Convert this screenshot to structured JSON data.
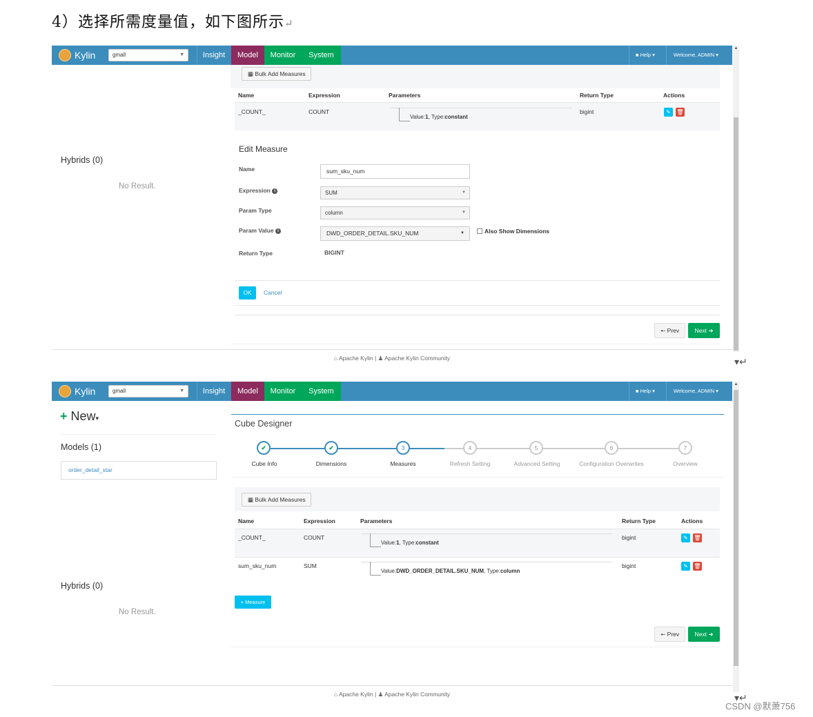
{
  "doc": {
    "heading": "4）选择所需度量值，如下图所示",
    "return_mark": "↵",
    "watermark": "CSDN @默萧756"
  },
  "nav": {
    "brand": "Kylin",
    "project": "gmall",
    "items": [
      "Insight",
      "Model",
      "Monitor",
      "System"
    ],
    "help": "Help ▾",
    "welcome": "Welcome, ADMIN ▾"
  },
  "sidebar": {
    "new_label": "New",
    "models_title": "Models (1)",
    "model_item": "order_detail_star",
    "hybrids_title": "Hybrids (0)",
    "no_result": "No Result."
  },
  "designer": {
    "title": "Cube Designer",
    "steps": [
      {
        "num": "✔",
        "label": "Cube Info"
      },
      {
        "num": "✔",
        "label": "Dimensions"
      },
      {
        "num": "3",
        "label": "Measures"
      },
      {
        "num": "4",
        "label": "Refresh Setting"
      },
      {
        "num": "5",
        "label": "Advanced Setting"
      },
      {
        "num": "6",
        "label": "Configuration Overwrites"
      },
      {
        "num": "7",
        "label": "Overview"
      }
    ]
  },
  "measures": {
    "bulk_label": "Bulk Add Measures",
    "headers": [
      "Name",
      "Expression",
      "Parameters",
      "Return Type",
      "Actions"
    ],
    "rows": [
      {
        "name": "_COUNT_",
        "expression": "COUNT",
        "value_label": "Value:",
        "value": "1",
        "type_label": ", Type:",
        "type": "constant",
        "return_type": "bigint"
      },
      {
        "name": "sum_sku_num",
        "expression": "SUM",
        "value_label": "Value:",
        "value": "DWD_ORDER_DETAIL.SKU_NUM",
        "type_label": ", Type:",
        "type": "column",
        "return_type": "bigint"
      }
    ],
    "add_label": "Measure"
  },
  "edit_measure": {
    "title": "Edit Measure",
    "name_label": "Name",
    "name_value": "sum_sku_num",
    "expression_label": "Expression",
    "expression_value": "SUM",
    "param_type_label": "Param Type",
    "param_type_value": "column",
    "param_value_label": "Param Value",
    "param_value_value": "DWD_ORDER_DETAIL.SKU_NUM",
    "also_show_label": "Also Show Dimensions",
    "return_type_label": "Return Type",
    "return_type_value": "BIGINT",
    "ok_label": "OK",
    "cancel_label": "Cancel"
  },
  "wizard": {
    "prev": "Prev",
    "next": "Next"
  },
  "footer": {
    "text1": "Apache Kylin",
    "sep": "|",
    "text2": "Apache Kylin Community"
  },
  "colors": {
    "navbar": "#3c8dbc",
    "model_active": "#8c2b5e",
    "system_green": "#00a65a",
    "next_green": "#00a65a",
    "info_blue": "#00c0ef",
    "danger_red": "#dd4b39"
  }
}
